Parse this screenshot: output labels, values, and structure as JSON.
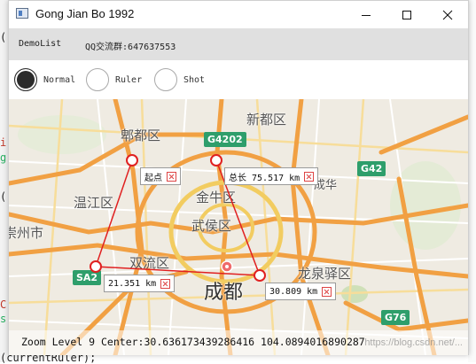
{
  "background_code": [
    "(",
    "i",
    "g",
    "(",
    "C",
    "s",
    "(currentRuler);"
  ],
  "window": {
    "title": "Gong Jian Bo 1992",
    "minimize_icon": "minimize-icon",
    "maximize_icon": "maximize-icon",
    "close_icon": "close-icon"
  },
  "menu": [
    {
      "label": "DemoList"
    },
    {
      "label": "QQ交流群:647637553"
    }
  ],
  "modes": [
    {
      "label": "Normal",
      "selected": true
    },
    {
      "label": "Ruler",
      "selected": false
    },
    {
      "label": "Shot",
      "selected": false
    }
  ],
  "map": {
    "places": {
      "xindu": "新都区",
      "pixian": "郫都区",
      "wenjiang": "温江区",
      "jinniu": "金牛区",
      "wuhou": "武侯区",
      "shuangliu": "双流区",
      "chengdu": "成都",
      "longquanyi": "龙泉驿区",
      "zhoushi": "崇州市",
      "chenghua": "成华"
    },
    "roads": {
      "g4202": "G4202",
      "g42": "G42",
      "g76": "G76",
      "sa2": "SA2"
    },
    "ruler": {
      "start_label": "起点",
      "total_label": "总长 75.517 km",
      "segment1_label": "21.351 km",
      "segment2_label": "30.809 km",
      "line_color": "#e02020"
    }
  },
  "status": {
    "text": "Zoom Level 9 Center:30.636173439286416 104.0894016890287",
    "watermark": "https://blog.csdn.net/..."
  },
  "colors": {
    "menu_bg": "#e0e0e0",
    "highway": "#f0a040",
    "ring_road": "#f2cc60"
  }
}
